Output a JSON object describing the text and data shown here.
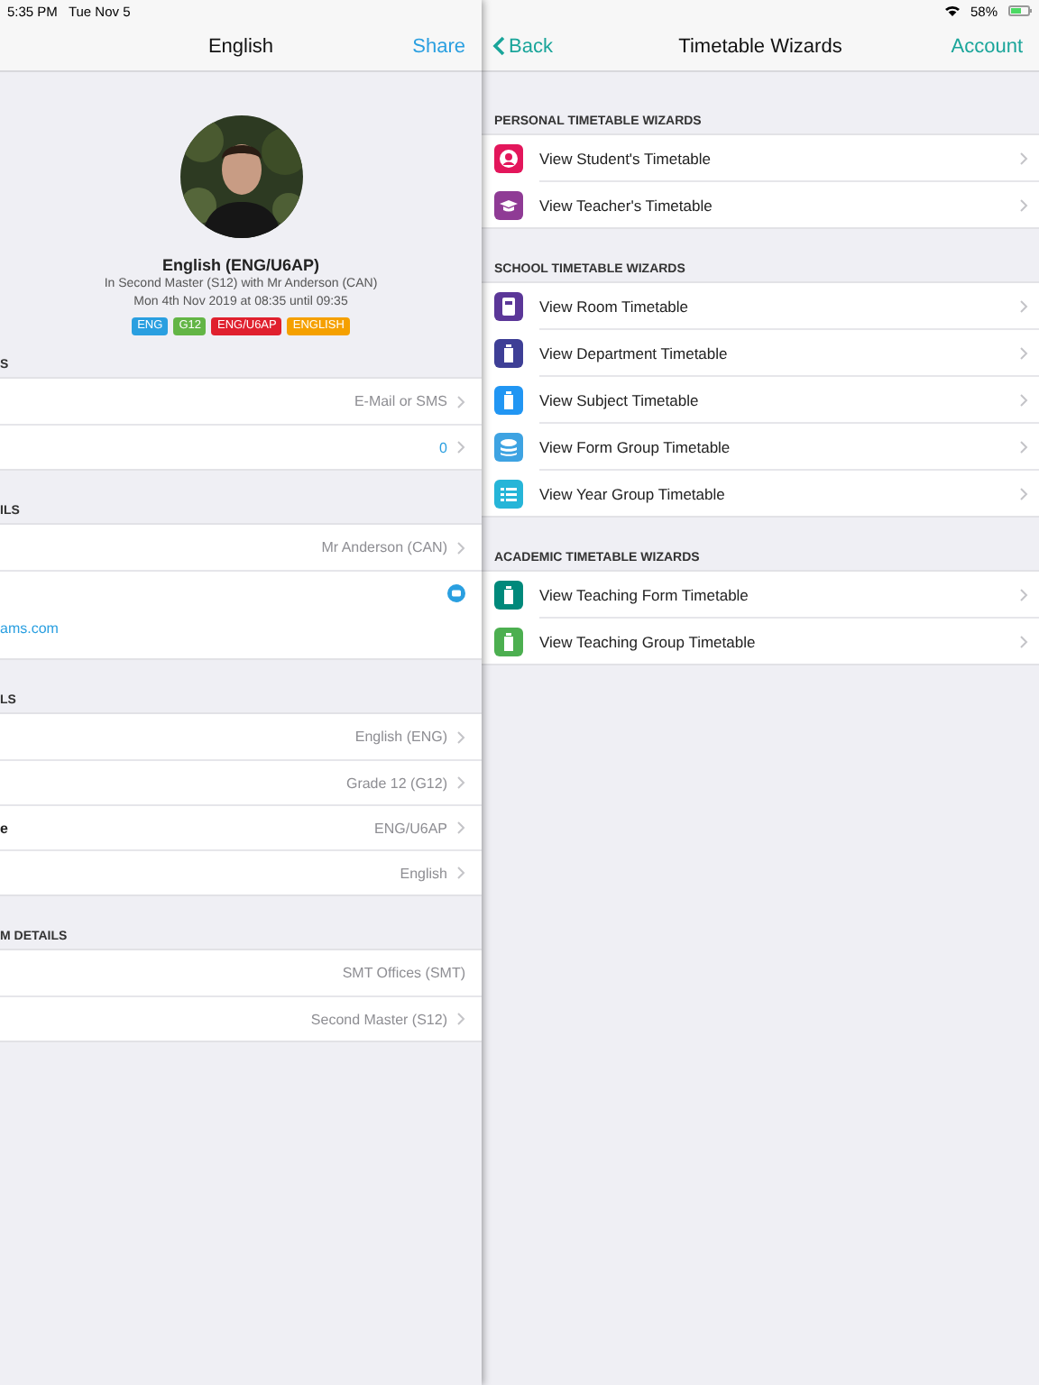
{
  "status_bar": {
    "time": "5:35 PM",
    "date": "Tue Nov 5",
    "battery": "58%"
  },
  "detail": {
    "nav": {
      "title": "English",
      "action": "Share"
    },
    "profile": {
      "photo": {
        "kind": "picture"
      },
      "title": "English (ENG/U6AP)",
      "lines": [
        "In Second Master (S12) with Mr Anderson (CAN)",
        "Mon 4th Nov 2019 at 08:35 until 09:35"
      ],
      "tags": [
        {
          "label": "ENG",
          "color": "#2a9fe0"
        },
        {
          "label": "G12",
          "color": "#63b545"
        },
        {
          "label": "ENG/U6AP",
          "color": "#e0202e"
        },
        {
          "label": "ENGLISH",
          "color": "#f5a000"
        }
      ]
    },
    "sections": [
      {
        "header": "S",
        "rows": [
          {
            "kind": "value",
            "value": "E-Mail or SMS",
            "chevron": true
          },
          {
            "kind": "link",
            "value": "0",
            "chevron": true
          }
        ]
      },
      {
        "header": "ILS",
        "rows": [
          {
            "kind": "value",
            "value": "Mr Anderson (CAN)",
            "chevron": true
          },
          {
            "kind": "email",
            "value": "ams.com"
          }
        ]
      },
      {
        "header": "LS",
        "rows": [
          {
            "kind": "value",
            "value": "English (ENG)",
            "chevron": true
          },
          {
            "kind": "value",
            "value": "Grade 12 (G12)",
            "chevron": true
          },
          {
            "kind": "value",
            "label": "e",
            "value": "ENG/U6AP",
            "chevron": true
          },
          {
            "kind": "value",
            "value": "English",
            "chevron": true
          }
        ]
      },
      {
        "header": "M DETAILS",
        "rows": [
          {
            "kind": "value",
            "value": "SMT Offices (SMT)",
            "chevron": false
          },
          {
            "kind": "value",
            "value": "Second Master (S12)",
            "chevron": true
          }
        ]
      }
    ]
  },
  "wizards": {
    "nav": {
      "back": "Back",
      "title": "Timetable Wizards",
      "action": "Account"
    },
    "sections": [
      {
        "header": "PERSONAL TIMETABLE WIZARDS",
        "items": [
          {
            "label": "View Student's Timetable",
            "kind": "person",
            "color": "#e3165b"
          },
          {
            "label": "View Teacher's Timetable",
            "kind": "cap",
            "color": "#8f3b95"
          }
        ]
      },
      {
        "header": "SCHOOL TIMETABLE WIZARDS",
        "items": [
          {
            "label": "View Room Timetable",
            "kind": "book",
            "color": "#5b3798"
          },
          {
            "label": "View Department Timetable",
            "kind": "bin",
            "color": "#3e3f96"
          },
          {
            "label": "View Subject Timetable",
            "kind": "bin",
            "color": "#2196f3"
          },
          {
            "label": "View Form Group Timetable",
            "kind": "layers",
            "color": "#3ea3e2"
          },
          {
            "label": "View Year Group Timetable",
            "kind": "list",
            "color": "#26b5d8"
          }
        ]
      },
      {
        "header": "ACADEMIC TIMETABLE WIZARDS",
        "items": [
          {
            "label": "View Teaching Form Timetable",
            "kind": "bin",
            "color": "#00897b"
          },
          {
            "label": "View Teaching Group Timetable",
            "kind": "bin",
            "color": "#4caf50"
          }
        ]
      }
    ]
  }
}
